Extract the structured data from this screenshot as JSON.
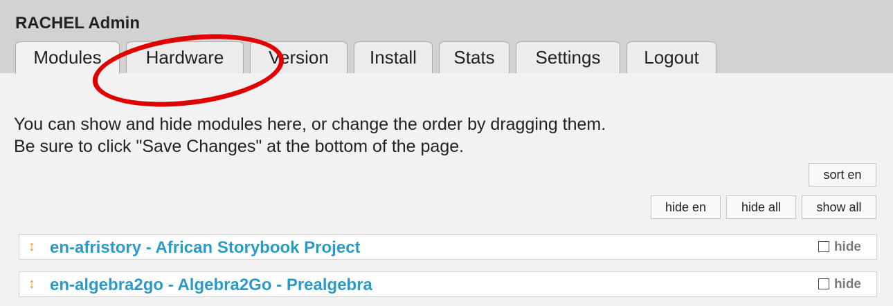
{
  "app_title": "RACHEL Admin",
  "tabs": [
    {
      "label": "Modules",
      "active": true
    },
    {
      "label": "Hardware",
      "active": false
    },
    {
      "label": "Version",
      "active": false
    },
    {
      "label": "Install",
      "active": false
    },
    {
      "label": "Stats",
      "active": false
    },
    {
      "label": "Settings",
      "active": false
    },
    {
      "label": "Logout",
      "active": false
    }
  ],
  "intro": {
    "line1": "You can show and hide modules here, or change the order by dragging them.",
    "line2": "Be sure to click \"Save Changes\" at the bottom of the page."
  },
  "actions": {
    "sort_en": "sort en",
    "hide_en": "hide en",
    "hide_all": "hide all",
    "show_all": "show all"
  },
  "modules": [
    {
      "title": "en-afristory - African Storybook Project",
      "hide_label": "hide",
      "hidden": false
    },
    {
      "title": "en-algebra2go - Algebra2Go - Prealgebra",
      "hide_label": "hide",
      "hidden": false
    }
  ],
  "icons": {
    "drag": "drag-handle-icon"
  },
  "colors": {
    "header_bg": "#d2d2d2",
    "module_title": "#2a9ac8",
    "drag_handle": "#e49a1a",
    "annotation": "#e00000"
  }
}
